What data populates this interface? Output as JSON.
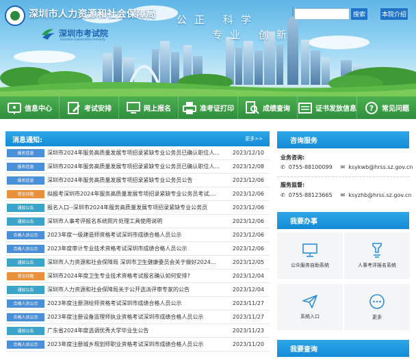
{
  "header": {
    "org_title": "深圳市人力资源和社会保障局",
    "authority_name": "深圳市考试院",
    "authority_subtitle": "Shenzhen Examination Authority",
    "slogan_line1": "公正 科学",
    "slogan_line2": "专业 创新",
    "search": {
      "placeholder": "",
      "button_label": "搜索"
    },
    "about_label": "本院介绍"
  },
  "nav": [
    {
      "label": "信息中心",
      "icon": "info-icon"
    },
    {
      "label": "考试安排",
      "icon": "edit-icon"
    },
    {
      "label": "网上报名",
      "icon": "monitor-icon"
    },
    {
      "label": "准考证打印",
      "icon": "printer-icon"
    },
    {
      "label": "成绩查询",
      "icon": "search-doc-icon"
    },
    {
      "label": "证书发放信息",
      "icon": "certificate-icon"
    },
    {
      "label": "常见问题",
      "icon": "question-icon"
    }
  ],
  "notices": {
    "title": "消息通知:",
    "more": "更多>>",
    "items": [
      {
        "badge": "报名信息",
        "title": "深圳市2024年服务高质量发展专项招录紧缺专业公务员已确认职位人...",
        "date": "2023/12/10"
      },
      {
        "badge": "报名信息",
        "title": "深圳市2024年服务高质量发展专项招录紧缺专业公务员已确认职位人...",
        "date": "2023/12/08"
      },
      {
        "badge": "报名信息",
        "title": "深圳市2024年服务高质量发展专项招录紧缺专业公务员公告",
        "date": "2023/12/06"
      },
      {
        "badge": "常见问题",
        "title": "拟报考深圳市2024年服务高质量发展专项招录紧缺专业公务员考试,...",
        "date": "2023/12/06"
      },
      {
        "badge": "通知公告",
        "title": "报名入口--深圳市2024年服务高质量发展专项招录紧缺专业公务员",
        "date": "2023/12/06"
      },
      {
        "badge": "通知公告",
        "title": "深圳市人事考评报名系统照片处理工具使用说明",
        "date": "2023/12/06"
      },
      {
        "badge": "合格人员公示",
        "title": "2023年度一级建造师资格考试深圳市成绩合格人员公示",
        "date": "2023/12/06"
      },
      {
        "badge": "合格人员公示",
        "title": "2023年度审计专业技术资格考试深圳市成绩合格人员公示",
        "date": "2023/12/06"
      },
      {
        "badge": "通知公告",
        "title": "深圳市人力资源和社会保障局 深圳市卫生健康委员会关于做好2024...",
        "date": "2023/12/05"
      },
      {
        "badge": "常见问题",
        "title": "深圳市2024年度卫生专业技术资格考试报名确认如何安排?",
        "date": "2023/12/04"
      },
      {
        "badge": "通知公告",
        "title": "深圳市人力资源和社会保障局关于公开选派评审专家的公告",
        "date": "2023/12/04"
      },
      {
        "badge": "合格人员公示",
        "title": "2023年度注册测绘师资格考试深圳市成绩合格人员公示",
        "date": "2023/11/27"
      },
      {
        "badge": "合格人员公示",
        "title": "2023年度注册设备监理师执业资格考试深圳市成绩合格人员公示",
        "date": "2023/11/27"
      },
      {
        "badge": "通知公告",
        "title": "广东省2024年度选调优秀大学毕业生公告",
        "date": "2023/11/23"
      },
      {
        "badge": "合格人员公示",
        "title": "2023年度注册城乡规划师职业资格考试深圳市成绩合格人员公示",
        "date": "2023/11/20"
      }
    ]
  },
  "contact": {
    "title": "咨询服务",
    "business_label": "业务咨询:",
    "business_phone": "0755-88100099",
    "business_email": "ksykwb@hrss.sz.gov.cn",
    "supervise_label": "服务监督:",
    "supervise_phone": "0755-88123665",
    "supervise_email": "ksyzhb@hrss.sz.gov.cn"
  },
  "services": {
    "title": "我要办事",
    "tiles": [
      {
        "label": "公众服务自助系统",
        "icon": "monitor-icon"
      },
      {
        "label": "人事考评报名系统",
        "icon": "pen-icon"
      },
      {
        "label": "系统入口",
        "icon": "send-icon"
      },
      {
        "label": "更多",
        "icon": "more-icon"
      }
    ]
  },
  "query": {
    "title": "我要查询"
  },
  "colors": {
    "badge_blue": "#4a90d9",
    "badge_teal": "#3aa5c8",
    "badge_orange": "#e8913a",
    "nav_green": "#3a9c45",
    "header_blue": "#1a8fd8"
  }
}
